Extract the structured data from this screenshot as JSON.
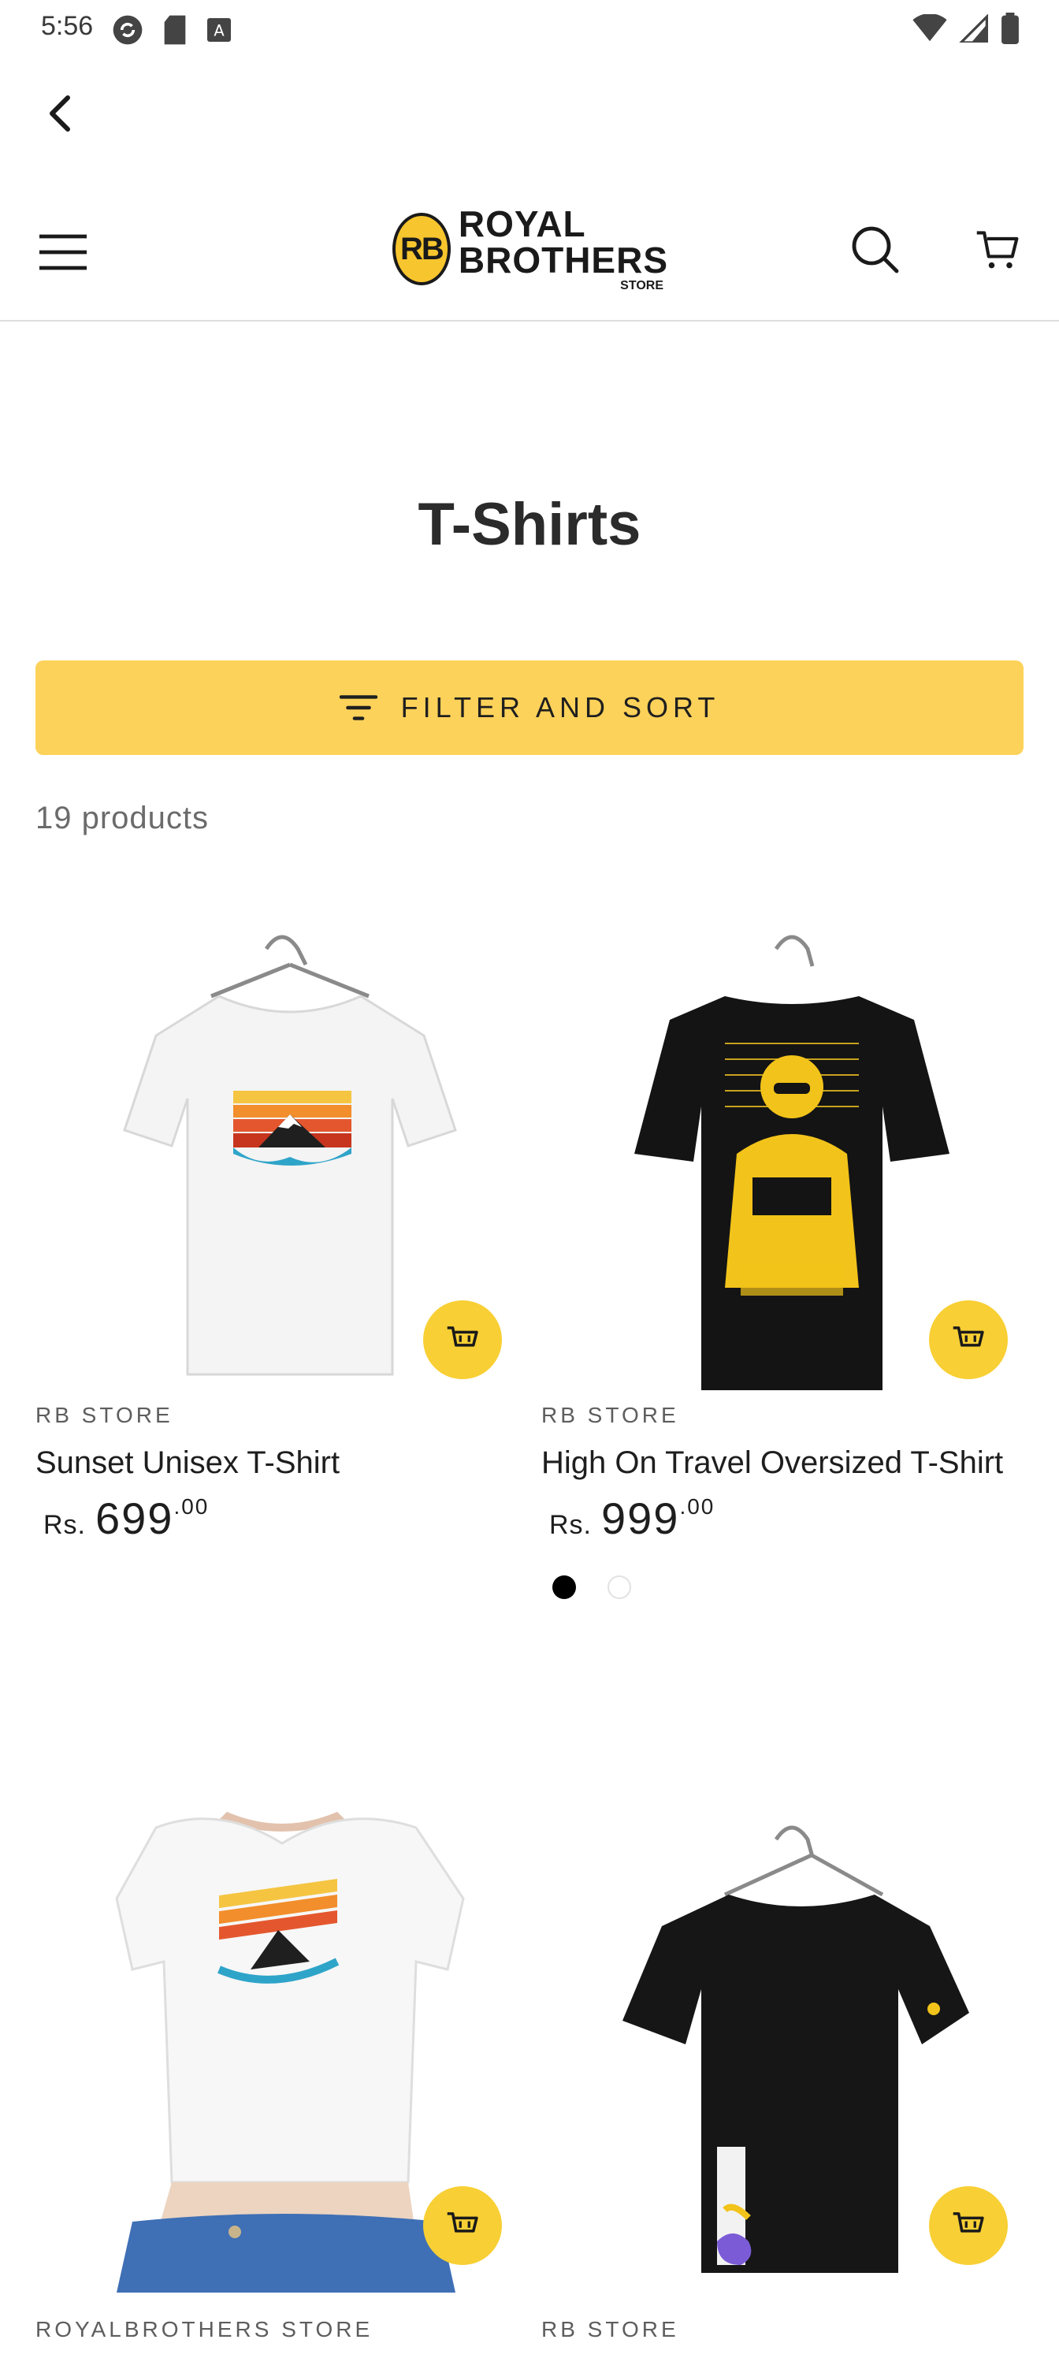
{
  "status": {
    "time": "5:56"
  },
  "header": {
    "logo": {
      "badge": "RB",
      "line1": "ROYAL",
      "line2": "BROTHERS",
      "line3": "STORE"
    }
  },
  "collection": {
    "title": "T-Shirts",
    "filter_label": "FILTER AND SORT",
    "count": "19 products"
  },
  "products": [
    {
      "vendor": "RB STORE",
      "name": "Sunset Unisex T-Shirt",
      "currency": "Rs.",
      "price": "699",
      "decimals": ".00",
      "swatches": []
    },
    {
      "vendor": "RB STORE",
      "name": "High On Travel Oversized T-Shirt",
      "currency": "Rs.",
      "price": "999",
      "decimals": ".00",
      "swatches": [
        "#000000",
        "#ffffff"
      ]
    },
    {
      "vendor": "ROYALBROTHERS STORE",
      "name": "",
      "currency": "",
      "price": "",
      "decimals": "",
      "swatches": []
    },
    {
      "vendor": "RB STORE",
      "name": "",
      "currency": "",
      "price": "",
      "decimals": "",
      "swatches": []
    }
  ],
  "colors": {
    "accent_yellow": "#fdd25a",
    "quick_add_yellow": "#f8cf34",
    "text_dark": "#121212",
    "text_muted": "#6b6b6b"
  },
  "icons": {
    "back": "chevron-left-icon",
    "menu": "hamburger-menu-icon",
    "search": "search-icon",
    "cart": "shopping-cart-icon",
    "filter": "filter-lines-icon",
    "quick_add": "add-to-cart-icon"
  }
}
